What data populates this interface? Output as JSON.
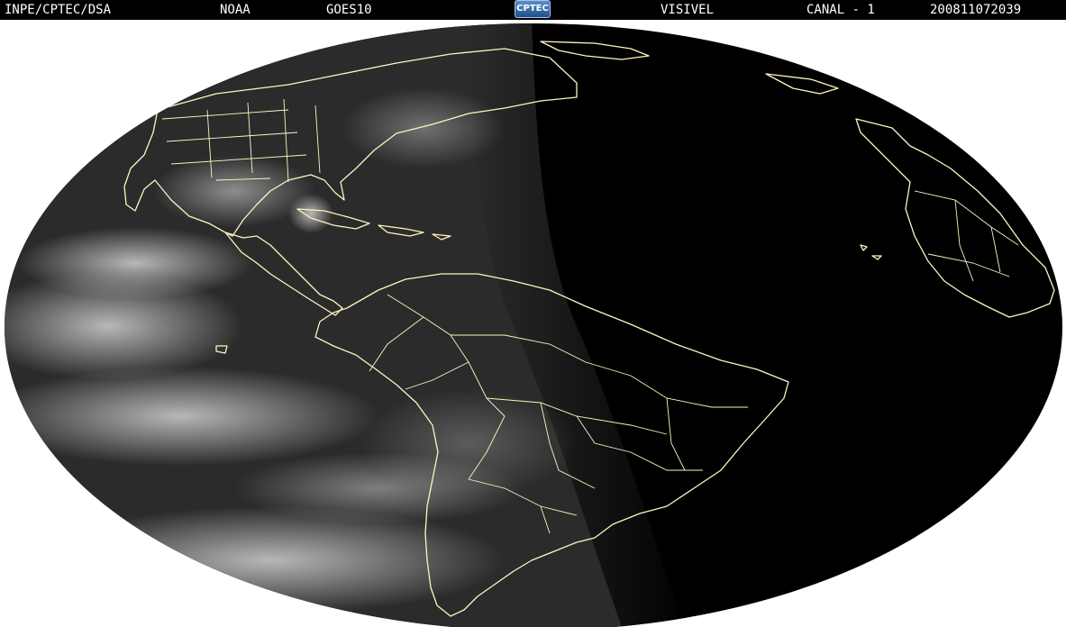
{
  "header": {
    "agency": "INPE/CPTEC/DSA",
    "source": "NOAA",
    "satellite": "GOES10",
    "logo_text": "CPTEC",
    "band": "VISIVEL",
    "channel": "CANAL - 1",
    "timestamp": "200811072039"
  },
  "colors": {
    "header_bg": "#000000",
    "header_text": "#ffffff",
    "page_bg": "#ffffff",
    "earth_night": "#000000",
    "earth_day": "#2b2b2b",
    "clouds": "#bdbdbd",
    "borders": "#fff5c0"
  }
}
